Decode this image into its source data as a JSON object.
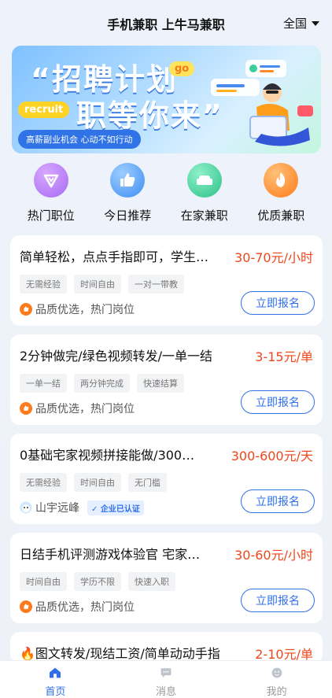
{
  "header": {
    "title": "手机兼职 上牛马兼职",
    "region": "全国"
  },
  "banner": {
    "headline1": "“招聘计划",
    "headline2": "职等你来”",
    "go_tag": "go",
    "recruit_tag": "recruit",
    "slogan": "高薪副业机会 心动不如行动"
  },
  "quick": [
    {
      "label": "热门职位",
      "icon": "heart-icon",
      "color": "#b57bf6"
    },
    {
      "label": "今日推荐",
      "icon": "thumbs-up-icon",
      "color": "#4d9ef5"
    },
    {
      "label": "在家兼职",
      "icon": "sofa-icon",
      "color": "#3ccf9a"
    },
    {
      "label": "优质兼职",
      "icon": "flame-icon",
      "color": "#ff8a2a"
    }
  ],
  "jobs": [
    {
      "title": "简单轻松，点点手指即可，学生…",
      "salary": "30-70元/小时",
      "tags": [
        "无需经验",
        "时间自由",
        "一对一带教"
      ],
      "meta": "品质优选，热门岗位",
      "apply": "立即报名"
    },
    {
      "title": "2分钟做完/绿色视频转发/一单一结",
      "salary": "3-15元/单",
      "tags": [
        "一单一结",
        "两分钟完成",
        "快速结算"
      ],
      "meta": "品质优选，热门岗位",
      "apply": "立即报名"
    },
    {
      "title": "0基础宅家视频拼接能做/300…",
      "salary": "300-600元/天",
      "tags": [
        "无需经验",
        "时间自由",
        "无门槛"
      ],
      "meta": "山宇远峰",
      "badge": "企业已认证",
      "apply": "立即报名"
    },
    {
      "title": "日结手机评测游戏体验官 宅家…",
      "salary": "30-60元/小时",
      "tags": [
        "时间自由",
        "学历不限",
        "快速入职"
      ],
      "meta": "品质优选，热门岗位",
      "apply": "立即报名"
    },
    {
      "title": "🔥图文转发/现结工资/简单动动手指",
      "salary": "2-10元/单"
    }
  ],
  "tabs": [
    {
      "label": "首页",
      "icon": "home-icon",
      "active": true
    },
    {
      "label": "消息",
      "icon": "message-icon",
      "active": false
    },
    {
      "label": "我的",
      "icon": "profile-icon",
      "active": false
    }
  ]
}
